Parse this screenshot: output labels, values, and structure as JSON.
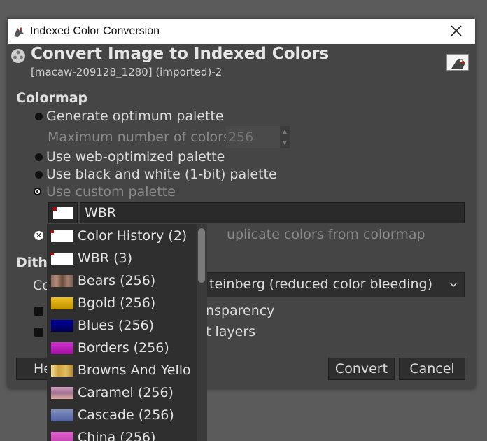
{
  "window": {
    "title": "Indexed Color Conversion",
    "close_icon": "close-icon"
  },
  "header": {
    "title": "Convert Image to Indexed Colors",
    "subtitle": "[macaw-209128_1280] (imported)-2"
  },
  "colormap": {
    "section_label": "Colormap",
    "generate_optimum": "Generate optimum palette",
    "max_colors_label": "Maximum number of colors:",
    "max_colors_value": "256",
    "web_optimized": "Use web-optimized palette",
    "black_white": "Use black and white (1-bit) palette",
    "custom_palette": "Use custom palette",
    "custom_palette_name": "WBR",
    "remove_unused_partial": "uplicate colors from colormap"
  },
  "dithering": {
    "section_label_partial": "Dith",
    "color_label_partial": "Co",
    "method_value": "teinberg (reduced color bleeding)",
    "transparency_partial": "nsparency",
    "text_layers_partial": "t layers"
  },
  "buttons": {
    "help_partial": "He",
    "convert": "Convert",
    "cancel": "Cancel"
  },
  "palette_popup": {
    "items": [
      {
        "label": "Color History (2)",
        "swatch": "white-red"
      },
      {
        "label": "WBR (3)",
        "swatch": "white-red"
      },
      {
        "label": "Bears (256)",
        "swatch": "bears"
      },
      {
        "label": "Bgold (256)",
        "swatch": "gold"
      },
      {
        "label": "Blues (256)",
        "swatch": "blues"
      },
      {
        "label": "Borders (256)",
        "swatch": "borders"
      },
      {
        "label": "Browns And Yello",
        "swatch": "browns"
      },
      {
        "label": "Caramel (256)",
        "swatch": "caramel"
      },
      {
        "label": "Cascade (256)",
        "swatch": "cascade"
      },
      {
        "label": "China (256)",
        "swatch": "china"
      }
    ]
  },
  "colors": {
    "dialog_bg": "#454545",
    "field_bg": "#2e2e2e",
    "text": "#dcdcdc"
  }
}
